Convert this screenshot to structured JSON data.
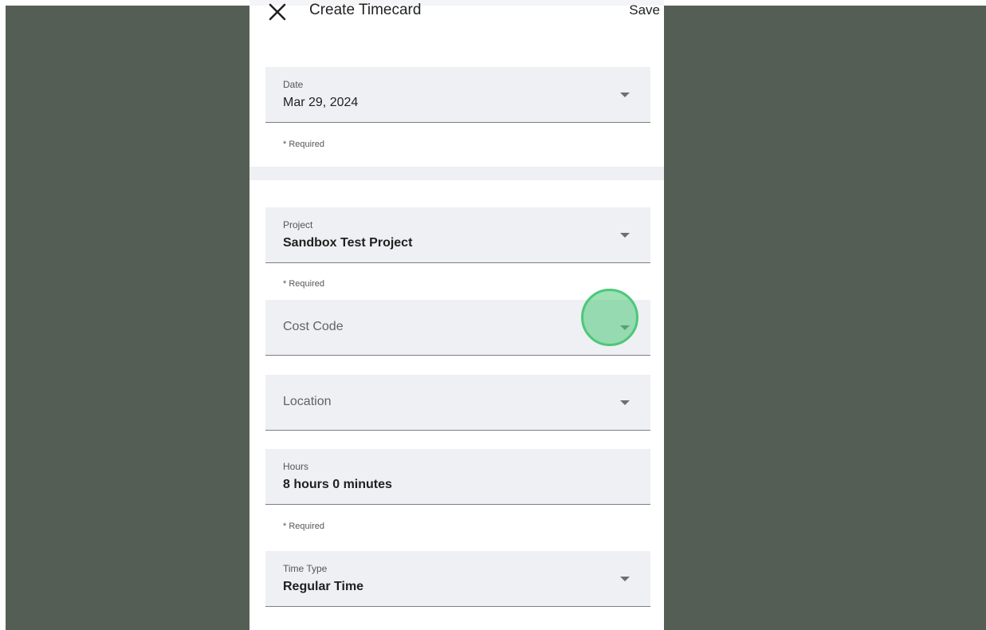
{
  "header": {
    "title": "Create Timecard",
    "save_label": "Save"
  },
  "form": {
    "date": {
      "label": "Date",
      "value": "Mar 29, 2024",
      "required_text": "* Required"
    },
    "project": {
      "label": "Project",
      "value": "Sandbox Test Project",
      "required_text": "* Required"
    },
    "cost_code": {
      "placeholder": "Cost Code"
    },
    "location": {
      "placeholder": "Location"
    },
    "hours": {
      "label": "Hours",
      "value": "8 hours 0 minutes",
      "required_text": "* Required"
    },
    "time_type": {
      "label": "Time Type",
      "value": "Regular Time"
    }
  },
  "colors": {
    "backdrop": "#555e54",
    "field_background": "#eef0f3",
    "tap_indicator": "#4cc878"
  },
  "icons": {
    "close": "close-icon",
    "dropdown": "chevron-down-icon"
  }
}
